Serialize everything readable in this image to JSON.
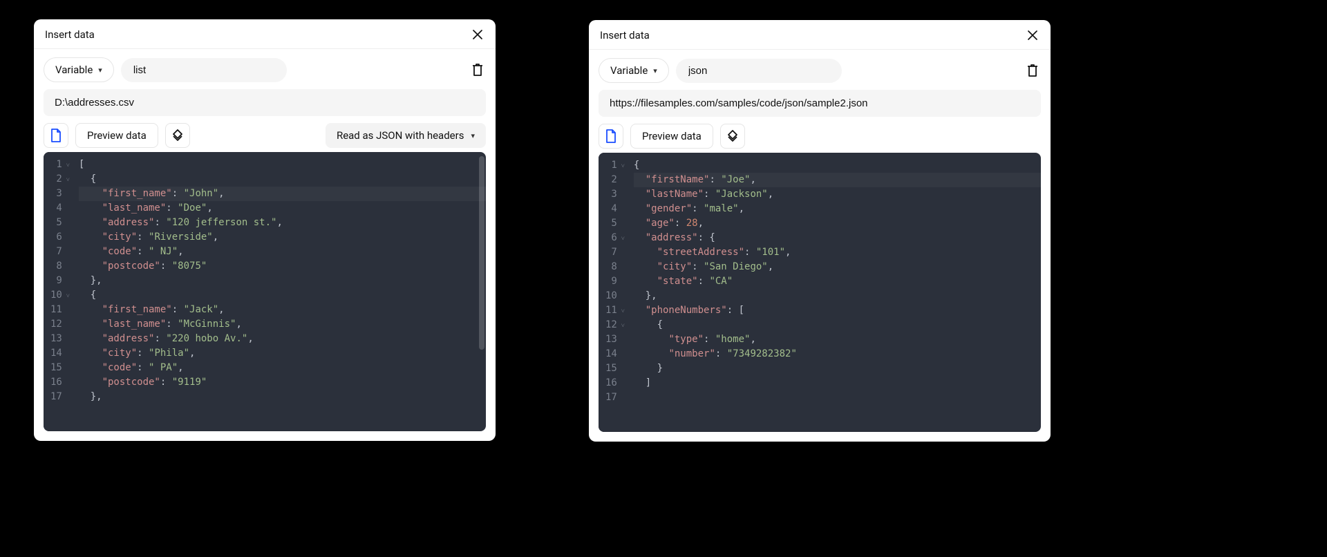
{
  "left": {
    "title": "Insert data",
    "type_label": "Variable",
    "var_name": "list",
    "path": "D:\\addresses.csv",
    "preview_label": "Preview data",
    "read_as_label": "Read as JSON with headers",
    "code_lines": [
      {
        "n": "1",
        "fold": true,
        "seg": [
          {
            "c": "p",
            "t": "["
          }
        ]
      },
      {
        "n": "2",
        "fold": true,
        "seg": [
          {
            "c": "p",
            "t": "  {"
          }
        ]
      },
      {
        "n": "3",
        "hl": true,
        "seg": [
          {
            "c": "p",
            "t": "    "
          },
          {
            "c": "k",
            "t": "\"first_name\""
          },
          {
            "c": "p",
            "t": ": "
          },
          {
            "c": "s",
            "t": "\"John\""
          },
          {
            "c": "p",
            "t": ","
          }
        ]
      },
      {
        "n": "4",
        "seg": [
          {
            "c": "p",
            "t": "    "
          },
          {
            "c": "k",
            "t": "\"last_name\""
          },
          {
            "c": "p",
            "t": ": "
          },
          {
            "c": "s",
            "t": "\"Doe\""
          },
          {
            "c": "p",
            "t": ","
          }
        ]
      },
      {
        "n": "5",
        "seg": [
          {
            "c": "p",
            "t": "    "
          },
          {
            "c": "k",
            "t": "\"address\""
          },
          {
            "c": "p",
            "t": ": "
          },
          {
            "c": "s",
            "t": "\"120 jefferson st.\""
          },
          {
            "c": "p",
            "t": ","
          }
        ]
      },
      {
        "n": "6",
        "seg": [
          {
            "c": "p",
            "t": "    "
          },
          {
            "c": "k",
            "t": "\"city\""
          },
          {
            "c": "p",
            "t": ": "
          },
          {
            "c": "s",
            "t": "\"Riverside\""
          },
          {
            "c": "p",
            "t": ","
          }
        ]
      },
      {
        "n": "7",
        "seg": [
          {
            "c": "p",
            "t": "    "
          },
          {
            "c": "k",
            "t": "\"code\""
          },
          {
            "c": "p",
            "t": ": "
          },
          {
            "c": "s",
            "t": "\" NJ\""
          },
          {
            "c": "p",
            "t": ","
          }
        ]
      },
      {
        "n": "8",
        "seg": [
          {
            "c": "p",
            "t": "    "
          },
          {
            "c": "k",
            "t": "\"postcode\""
          },
          {
            "c": "p",
            "t": ": "
          },
          {
            "c": "s",
            "t": "\"8075\""
          }
        ]
      },
      {
        "n": "9",
        "seg": [
          {
            "c": "p",
            "t": "  },"
          }
        ]
      },
      {
        "n": "10",
        "fold": true,
        "seg": [
          {
            "c": "p",
            "t": "  {"
          }
        ]
      },
      {
        "n": "11",
        "seg": [
          {
            "c": "p",
            "t": "    "
          },
          {
            "c": "k",
            "t": "\"first_name\""
          },
          {
            "c": "p",
            "t": ": "
          },
          {
            "c": "s",
            "t": "\"Jack\""
          },
          {
            "c": "p",
            "t": ","
          }
        ]
      },
      {
        "n": "12",
        "seg": [
          {
            "c": "p",
            "t": "    "
          },
          {
            "c": "k",
            "t": "\"last_name\""
          },
          {
            "c": "p",
            "t": ": "
          },
          {
            "c": "s",
            "t": "\"McGinnis\""
          },
          {
            "c": "p",
            "t": ","
          }
        ]
      },
      {
        "n": "13",
        "seg": [
          {
            "c": "p",
            "t": "    "
          },
          {
            "c": "k",
            "t": "\"address\""
          },
          {
            "c": "p",
            "t": ": "
          },
          {
            "c": "s",
            "t": "\"220 hobo Av.\""
          },
          {
            "c": "p",
            "t": ","
          }
        ]
      },
      {
        "n": "14",
        "seg": [
          {
            "c": "p",
            "t": "    "
          },
          {
            "c": "k",
            "t": "\"city\""
          },
          {
            "c": "p",
            "t": ": "
          },
          {
            "c": "s",
            "t": "\"Phila\""
          },
          {
            "c": "p",
            "t": ","
          }
        ]
      },
      {
        "n": "15",
        "seg": [
          {
            "c": "p",
            "t": "    "
          },
          {
            "c": "k",
            "t": "\"code\""
          },
          {
            "c": "p",
            "t": ": "
          },
          {
            "c": "s",
            "t": "\" PA\""
          },
          {
            "c": "p",
            "t": ","
          }
        ]
      },
      {
        "n": "16",
        "seg": [
          {
            "c": "p",
            "t": "    "
          },
          {
            "c": "k",
            "t": "\"postcode\""
          },
          {
            "c": "p",
            "t": ": "
          },
          {
            "c": "s",
            "t": "\"9119\""
          }
        ]
      },
      {
        "n": "17",
        "seg": [
          {
            "c": "p",
            "t": "  },"
          }
        ]
      }
    ]
  },
  "right": {
    "title": "Insert data",
    "type_label": "Variable",
    "var_name": "json",
    "path": "https://filesamples.com/samples/code/json/sample2.json",
    "preview_label": "Preview data",
    "code_lines": [
      {
        "n": "1",
        "fold": true,
        "seg": [
          {
            "c": "p",
            "t": "{"
          }
        ]
      },
      {
        "n": "2",
        "hl": true,
        "seg": [
          {
            "c": "p",
            "t": "  "
          },
          {
            "c": "k",
            "t": "\"firstName\""
          },
          {
            "c": "p",
            "t": ": "
          },
          {
            "c": "s",
            "t": "\"Joe\""
          },
          {
            "c": "p",
            "t": ","
          }
        ]
      },
      {
        "n": "3",
        "seg": [
          {
            "c": "p",
            "t": "  "
          },
          {
            "c": "k",
            "t": "\"lastName\""
          },
          {
            "c": "p",
            "t": ": "
          },
          {
            "c": "s",
            "t": "\"Jackson\""
          },
          {
            "c": "p",
            "t": ","
          }
        ]
      },
      {
        "n": "4",
        "seg": [
          {
            "c": "p",
            "t": "  "
          },
          {
            "c": "k",
            "t": "\"gender\""
          },
          {
            "c": "p",
            "t": ": "
          },
          {
            "c": "s",
            "t": "\"male\""
          },
          {
            "c": "p",
            "t": ","
          }
        ]
      },
      {
        "n": "5",
        "seg": [
          {
            "c": "p",
            "t": "  "
          },
          {
            "c": "k",
            "t": "\"age\""
          },
          {
            "c": "p",
            "t": ": "
          },
          {
            "c": "n",
            "t": "28"
          },
          {
            "c": "p",
            "t": ","
          }
        ]
      },
      {
        "n": "6",
        "fold": true,
        "seg": [
          {
            "c": "p",
            "t": "  "
          },
          {
            "c": "k",
            "t": "\"address\""
          },
          {
            "c": "p",
            "t": ": {"
          }
        ]
      },
      {
        "n": "7",
        "seg": [
          {
            "c": "p",
            "t": "    "
          },
          {
            "c": "k",
            "t": "\"streetAddress\""
          },
          {
            "c": "p",
            "t": ": "
          },
          {
            "c": "s",
            "t": "\"101\""
          },
          {
            "c": "p",
            "t": ","
          }
        ]
      },
      {
        "n": "8",
        "seg": [
          {
            "c": "p",
            "t": "    "
          },
          {
            "c": "k",
            "t": "\"city\""
          },
          {
            "c": "p",
            "t": ": "
          },
          {
            "c": "s",
            "t": "\"San Diego\""
          },
          {
            "c": "p",
            "t": ","
          }
        ]
      },
      {
        "n": "9",
        "seg": [
          {
            "c": "p",
            "t": "    "
          },
          {
            "c": "k",
            "t": "\"state\""
          },
          {
            "c": "p",
            "t": ": "
          },
          {
            "c": "s",
            "t": "\"CA\""
          }
        ]
      },
      {
        "n": "10",
        "seg": [
          {
            "c": "p",
            "t": "  },"
          }
        ]
      },
      {
        "n": "11",
        "fold": true,
        "seg": [
          {
            "c": "p",
            "t": "  "
          },
          {
            "c": "k",
            "t": "\"phoneNumbers\""
          },
          {
            "c": "p",
            "t": ": ["
          }
        ]
      },
      {
        "n": "12",
        "fold": true,
        "seg": [
          {
            "c": "p",
            "t": "    {"
          }
        ]
      },
      {
        "n": "13",
        "seg": [
          {
            "c": "p",
            "t": "      "
          },
          {
            "c": "k",
            "t": "\"type\""
          },
          {
            "c": "p",
            "t": ": "
          },
          {
            "c": "s",
            "t": "\"home\""
          },
          {
            "c": "p",
            "t": ","
          }
        ]
      },
      {
        "n": "14",
        "seg": [
          {
            "c": "p",
            "t": "      "
          },
          {
            "c": "k",
            "t": "\"number\""
          },
          {
            "c": "p",
            "t": ": "
          },
          {
            "c": "s",
            "t": "\"7349282382\""
          }
        ]
      },
      {
        "n": "15",
        "seg": [
          {
            "c": "p",
            "t": "    }"
          }
        ]
      },
      {
        "n": "16",
        "seg": [
          {
            "c": "p",
            "t": "  ]"
          }
        ]
      },
      {
        "n": "17",
        "seg": [
          {
            "c": "p",
            "t": ""
          }
        ]
      }
    ]
  }
}
